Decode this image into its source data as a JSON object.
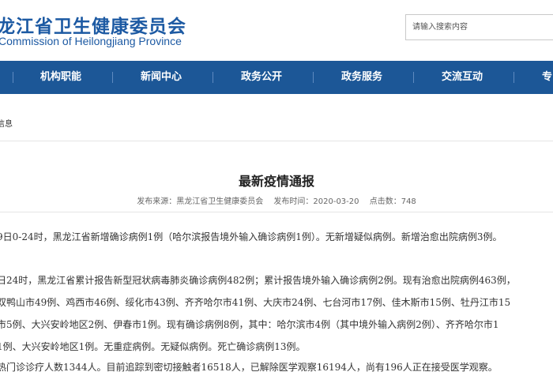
{
  "header": {
    "logo_cn": "龙江省卫生健康委员会",
    "logo_en": "Commission of Heilongjiang Province",
    "search_placeholder": "请输入搜索内容"
  },
  "nav": {
    "items": [
      {
        "label": "机构职能"
      },
      {
        "label": "新闻中心"
      },
      {
        "label": "政务公开"
      },
      {
        "label": "政务服务"
      },
      {
        "label": "交流互动"
      },
      {
        "label": "专"
      }
    ]
  },
  "breadcrumb": "信息",
  "article": {
    "title": "最新疫情通报",
    "source_label": "发布来源：黑龙江省卫生健康委员会",
    "time_label": "发布时间：2020-03-20",
    "views_label": "点击数：748",
    "lines": [
      "9日0-24时，黑龙江省新增确诊病例1例（哈尔滨报告境外输入确诊病例1例）。无新增疑似病例。新增治愈出院病例3例。",
      "日24时，黑龙江省累计报告新型冠状病毒肺炎确诊病例482例；累计报告境外输入确诊病例2例。现有治愈出院病例463例，",
      "双鸭山市49例、鸡西市46例、绥化市43例、齐齐哈尔市41例、大庆市24例、七台河市17例、佳木斯市15例、牡丹江市15",
      "市5例、大兴安岭地区2例、伊春市1例。现有确诊病例8例，其中：哈尔滨市4例（其中境外输入病例2例）、齐齐哈尔市1",
      "1例、大兴安岭地区1例。无重症病例。无疑似病例。死亡确诊病例13例。",
      "热门诊诊疗人数1344人。目前追踪到密切接触者16518人，已解除医学观察16194人，尚有196人正在接受医学观察。"
    ]
  },
  "colors": {
    "nav_bg": "#1c5797",
    "logo": "#1d5aa3"
  }
}
